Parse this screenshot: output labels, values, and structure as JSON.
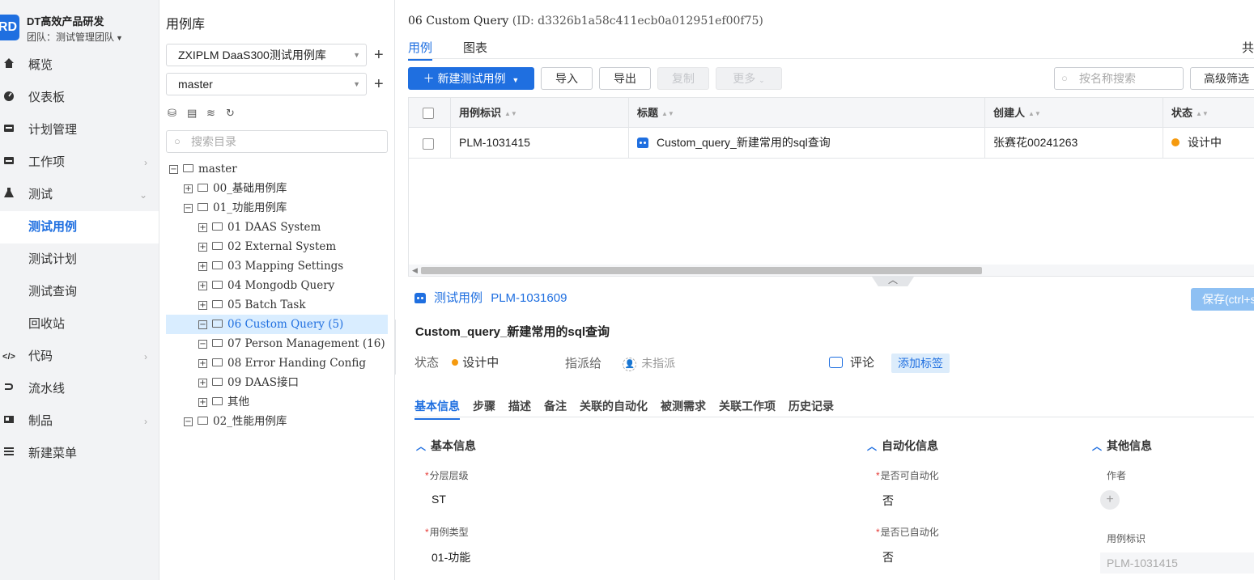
{
  "brand": {
    "logo": "RD",
    "name": "DT高效产品研发",
    "team": "团队：测试管理团队"
  },
  "nav": [
    {
      "icon": "home-icon",
      "label": "概览",
      "arrow": false
    },
    {
      "icon": "dashboard-icon",
      "label": "仪表板",
      "arrow": false
    },
    {
      "icon": "plan-icon",
      "label": "计划管理",
      "arrow": false
    },
    {
      "icon": "workitem-icon",
      "label": "工作项",
      "arrow": true
    },
    {
      "icon": "flask-icon",
      "label": "测试",
      "arrow": true
    },
    {
      "icon": "",
      "label": "测试用例",
      "arrow": false,
      "active": true
    },
    {
      "icon": "",
      "label": "测试计划",
      "arrow": false
    },
    {
      "icon": "",
      "label": "测试查询",
      "arrow": false
    },
    {
      "icon": "",
      "label": "回收站",
      "arrow": false
    },
    {
      "icon": "code-icon",
      "label": "代码",
      "arrow": true
    },
    {
      "icon": "pipeline-icon",
      "label": "流水线",
      "arrow": false
    },
    {
      "icon": "artifact-icon",
      "label": "制品",
      "arrow": true
    },
    {
      "icon": "menu-icon",
      "label": "新建菜单",
      "arrow": false
    }
  ],
  "tree_panel": {
    "title": "用例库",
    "library_select": "ZXIPLM DaaS300测试用例库",
    "branch_select": "master",
    "search_placeholder": "搜索目录",
    "nodes": [
      {
        "label": "master",
        "level": 0,
        "toggle": "⊟"
      },
      {
        "label": "00_基础用例库",
        "level": 1,
        "toggle": "⊞"
      },
      {
        "label": "01_功能用例库",
        "level": 1,
        "toggle": "⊟"
      },
      {
        "label": "01 DAAS System",
        "level": 2,
        "toggle": "⊞"
      },
      {
        "label": "02 External System",
        "level": 2,
        "toggle": "⊞"
      },
      {
        "label": "03 Mapping Settings",
        "level": 2,
        "toggle": "⊞"
      },
      {
        "label": "04 Mongodb Query",
        "level": 2,
        "toggle": "⊞"
      },
      {
        "label": "05 Batch Task",
        "level": 2,
        "toggle": "⊞"
      },
      {
        "label": "06 Custom Query (5)",
        "level": 2,
        "toggle": "⊟",
        "selected": true
      },
      {
        "label": "07 Person Management (16)",
        "level": 2,
        "toggle": "⊟"
      },
      {
        "label": "08 Error Handing Config",
        "level": 2,
        "toggle": "⊞"
      },
      {
        "label": "09 DAAS接口",
        "level": 2,
        "toggle": "⊞"
      },
      {
        "label": "其他",
        "level": 2,
        "toggle": "⊞"
      },
      {
        "label": "02_性能用例库",
        "level": 1,
        "toggle": "⊟"
      }
    ]
  },
  "main": {
    "crumb_name": "06 Custom Query",
    "crumb_id": "(ID: d3326b1a58c411ecb0a012951ef00f75)",
    "tabs": [
      "用例",
      "图表"
    ],
    "tab_right": "共",
    "toolbar": {
      "new_case": "＋ 新建测试用例",
      "import": "导入",
      "export": "导出",
      "copy": "复制",
      "more": "更多",
      "search_placeholder": "按名称搜索",
      "advanced_filter": "高级筛选"
    },
    "columns": [
      "用例标识",
      "标题",
      "创建人",
      "状态"
    ],
    "rows": [
      {
        "id": "PLM-1031415",
        "title": "Custom_query_新建常用的sql查询",
        "creator": "张赛花00241263",
        "status": "设计中"
      }
    ]
  },
  "detail": {
    "type_label": "测试用例",
    "case_id": "PLM-1031609",
    "save_label": "保存(ctrl+s)",
    "title": "Custom_query_新建常用的sql查询",
    "status_key": "状态",
    "status_value": "设计中",
    "assign_key": "指派给",
    "assign_value": "未指派",
    "comment": "评论",
    "add_tag": "添加标签",
    "tabs": [
      "基本信息",
      "步骤",
      "描述",
      "备注",
      "关联的自动化",
      "被测需求",
      "关联工作项",
      "历史记录"
    ],
    "sections": {
      "basic": "基本信息",
      "automation": "自动化信息",
      "other": "其他信息"
    },
    "fields": {
      "layer_label": "分层层级",
      "layer_value": "ST",
      "type_label": "用例类型",
      "type_value": "01-功能",
      "can_auto_label": "是否可自动化",
      "can_auto_value": "否",
      "is_auto_label": "是否已自动化",
      "is_auto_value": "否",
      "author_label": "作者",
      "case_id_label": "用例标识",
      "case_id_value": "PLM-1031415"
    }
  },
  "colors": {
    "accent": "#1f6fe0",
    "status_designing": "#f59a0f",
    "required": "#e53935"
  }
}
